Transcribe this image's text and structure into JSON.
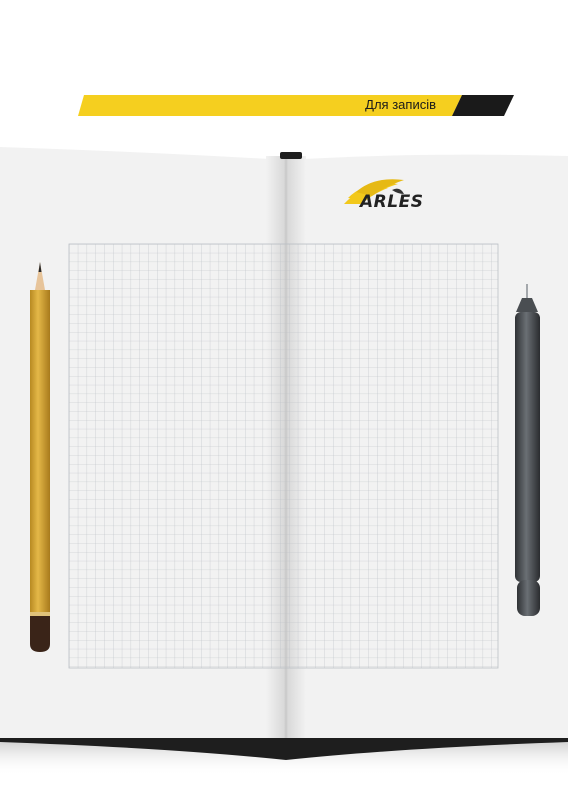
{
  "banner": {
    "label": "Для записів",
    "bar_color": "#f5cf1f",
    "accent_color": "#1a1a1a"
  },
  "logo": {
    "text": "ARLES",
    "mark_color": "#f2c81b"
  },
  "notebook": {
    "page_color": "#f2f2f2",
    "grid_color": "#b9bec4",
    "cover_color": "#1e1e1e"
  },
  "pencil": {
    "body_color": "#d7a93a",
    "ferrule_color": "#3a2418"
  },
  "pen": {
    "body_color": "#555a5f"
  }
}
